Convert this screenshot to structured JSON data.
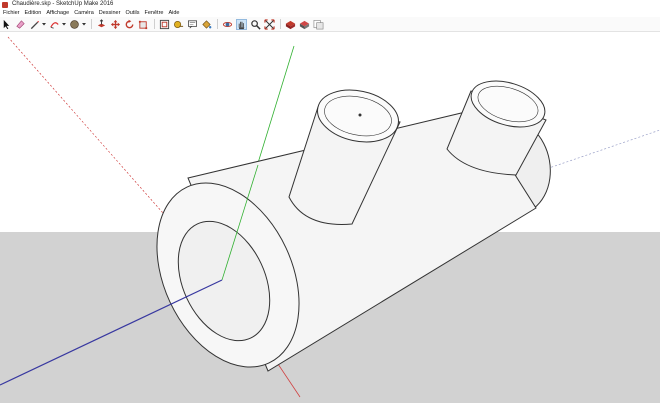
{
  "window": {
    "title": "Chaudière.skp - SketchUp Make 2016"
  },
  "menu": [
    "Fichier",
    "Edition",
    "Affichage",
    "Caméra",
    "Dessiner",
    "Outils",
    "Fenêtre",
    "Aide"
  ],
  "colors": {
    "sky": "#ffffff",
    "ground": "#d2d2d2",
    "model_fill": "#f3f3f3",
    "model_stroke": "#333333",
    "axis_red": "#d04040",
    "axis_green": "#30b030",
    "axis_blue": "#3838a0"
  },
  "toolbar": {
    "tools": [
      {
        "icon": "select-arrow-icon",
        "label": "Sélectionner"
      },
      {
        "icon": "eraser-icon",
        "label": "Gomme"
      },
      {
        "icon": "pencil-line-icon",
        "label": "Trait"
      },
      {
        "icon": "arc-icon",
        "label": "Arc"
      },
      {
        "icon": "shape-icon",
        "label": "Formes"
      },
      {
        "icon": "push-pull-icon",
        "label": "Pousser/tirer"
      },
      {
        "icon": "move-icon",
        "label": "Déplacer"
      },
      {
        "icon": "rotate-icon",
        "label": "Faire pivoter"
      },
      {
        "icon": "scale-icon",
        "label": "Échelle"
      },
      {
        "icon": "offset-icon",
        "label": "Décaler"
      },
      {
        "icon": "tape-measure-icon",
        "label": "Mètre"
      },
      {
        "icon": "text-icon",
        "label": "Texte"
      },
      {
        "icon": "paint-bucket-icon",
        "label": "Colorer"
      },
      {
        "icon": "orbit-icon",
        "label": "Orbite"
      },
      {
        "icon": "pan-hand-icon",
        "label": "Panoramique"
      },
      {
        "icon": "zoom-icon",
        "label": "Zoom"
      },
      {
        "icon": "zoom-extents-icon",
        "label": "Zoom étendu"
      },
      {
        "icon": "3d-warehouse-icon",
        "label": "3D Warehouse"
      },
      {
        "icon": "extension-warehouse-icon",
        "label": "Extension Warehouse"
      },
      {
        "icon": "layout-send-icon",
        "label": "Envoyer vers LayOut"
      }
    ]
  }
}
